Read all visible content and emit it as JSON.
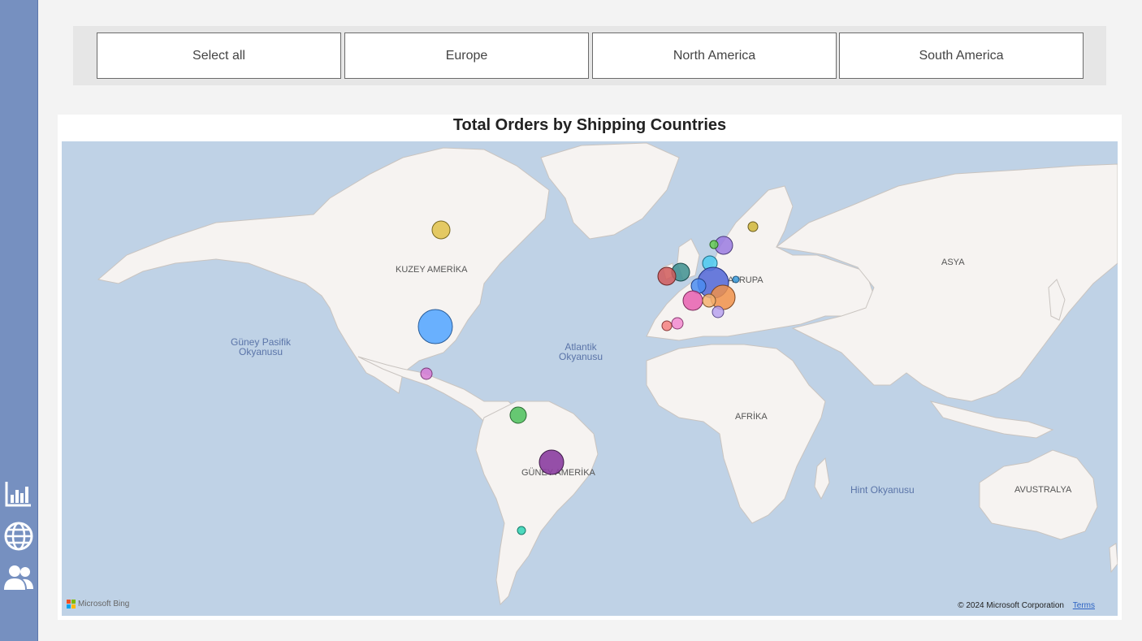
{
  "slicer": {
    "options": [
      "Select all",
      "Europe",
      "North America",
      "South America"
    ]
  },
  "map": {
    "title": "Total Orders by Shipping Countries",
    "labels": {
      "north_america": "KUZEY AMERİKA",
      "south_america": "GÜNEY AMERİKA",
      "europe": "AVRUPA",
      "asia": "ASYA",
      "africa": "AFRİKA",
      "australia": "AVUSTRALYA",
      "south_pacific": "Güney Pasifik\nOkyanusu",
      "atlantic": "Atlantik\nOkyanusu",
      "indian": "Hint Okyanusu"
    },
    "attribution": "Microsoft Bing",
    "copyright": "© 2024 Microsoft Corporation",
    "terms": "Terms"
  },
  "nav": {
    "icons": [
      "bar-chart-icon",
      "globe-icon",
      "users-icon"
    ]
  },
  "colors": {
    "sidebar": "#7690c0",
    "water": "#bfd2e6",
    "land": "#f6f3f1"
  }
}
